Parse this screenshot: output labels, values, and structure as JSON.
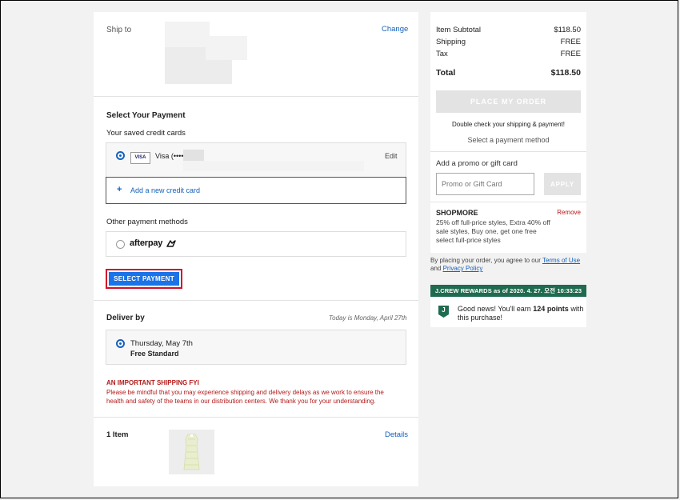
{
  "shipto": {
    "label": "Ship to",
    "change_link": "Change"
  },
  "payment": {
    "heading": "Select Your Payment",
    "saved_heading": "Your saved credit cards",
    "card_badge": "VISA",
    "card_label": "Visa (••••",
    "edit_link": "Edit",
    "add_card_plus": "+",
    "add_card_link": "Add a new credit card",
    "other_heading": "Other payment methods",
    "afterpay_label": "afterpay",
    "select_button": "SELECT PAYMENT"
  },
  "delivery": {
    "heading": "Deliver by",
    "today_note": "Today is Monday, April 27th",
    "option_date": "Thursday, May 7th",
    "option_method": "Free Standard",
    "fyi_title": "AN IMPORTANT SHIPPING FYI",
    "fyi_line1": "Please be mindful that you may experience shipping and delivery delays as we work to ensure the",
    "fyi_line2": "health and safety of the teams in our distribution centers. We thank you for your understanding."
  },
  "items": {
    "count_label": "1 Item",
    "details_link": "Details"
  },
  "summary": {
    "subtotal_label": "Item Subtotal",
    "subtotal_value": "$118.50",
    "shipping_label": "Shipping",
    "shipping_value": "FREE",
    "tax_label": "Tax",
    "tax_value": "FREE",
    "total_label": "Total",
    "total_value": "$118.50",
    "place_order_button": "PLACE MY ORDER",
    "double_check_note": "Double check your shipping & payment!",
    "select_method_note": "Select a payment method"
  },
  "promo": {
    "heading": "Add a promo or gift card",
    "input_placeholder": "Promo or Gift Card",
    "apply_button": "APPLY",
    "code": "SHOPMORE",
    "remove_link": "Remove",
    "desc_line1": "25% off full-price styles, Extra 40% off",
    "desc_line2": "sale styles, Buy one, get one free",
    "desc_line3": "select full-price styles"
  },
  "terms": {
    "prefix": "By placing your order, you agree to our ",
    "terms_link": "Terms of Use",
    "and_text": "and ",
    "privacy_link": "Privacy Policy"
  },
  "rewards": {
    "banner": "J.CREW REWARDS as of 2020. 4. 27. 오전 10:33:23",
    "badge_letter": "J",
    "msg_prefix": "Good news! You'll earn ",
    "points": "124 points",
    "msg_suffix": " with",
    "msg_line2": "this purchase!"
  },
  "colors": {
    "accent_blue": "#1560bd",
    "button_blue": "#1a73e8",
    "alert_red": "#b31a1a",
    "rewards_green": "#1f6b4f"
  }
}
